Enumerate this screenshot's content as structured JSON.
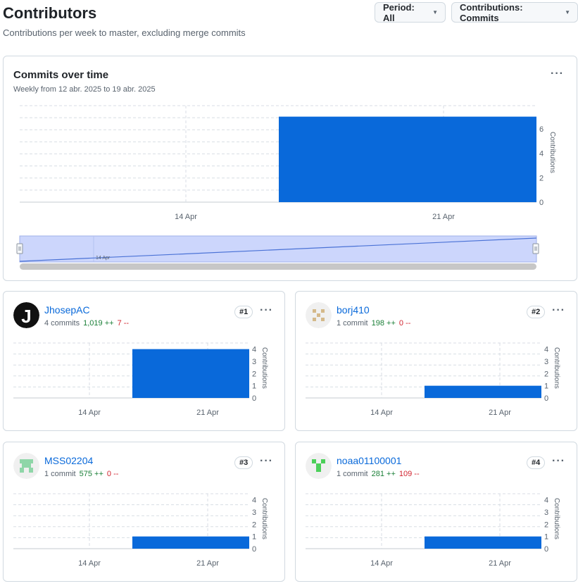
{
  "page": {
    "title": "Contributors",
    "subtitle": "Contributions per week to master, excluding merge commits"
  },
  "filters": {
    "period_label": "Period: All",
    "contributions_label": "Contributions: Commits"
  },
  "colors": {
    "bar": "#0969da",
    "grid": "#d8dee4",
    "navigator_fill": "#ccd6fc",
    "navigator_line": "#4a72d6",
    "additions": "#1a7f37",
    "deletions": "#d1242f",
    "link": "#0969da"
  },
  "main_chart": {
    "title": "Commits over time",
    "subtitle": "Weekly from 12 abr. 2025 to 19 abr. 2025",
    "more_label": "···",
    "navigator_label": "14 Apr",
    "chart_data": {
      "type": "bar",
      "x_ticks": [
        "14 Apr",
        "21 Apr"
      ],
      "bars": [
        {
          "week": "21 Apr",
          "value": 7
        }
      ],
      "ylabel": "Contributions",
      "y_ticks": [
        0,
        2,
        4,
        6
      ],
      "ylim": [
        0,
        7.9
      ],
      "grid": true
    }
  },
  "contributors": [
    {
      "username": "JhosepAC",
      "commits": "4 commits",
      "additions": "1,019 ++",
      "deletions": "7 --",
      "rank": "#1",
      "avatar_icon": "letter-j-avatar-icon",
      "chart_data": {
        "type": "bar",
        "x_ticks": [
          "14 Apr",
          "21 Apr"
        ],
        "value": 4,
        "y_ticks": [
          0,
          1,
          2,
          3,
          4
        ],
        "ylim": [
          0,
          4.5
        ],
        "ylabel": "Contributions"
      }
    },
    {
      "username": "borj410",
      "commits": "1 commit",
      "additions": "198 ++",
      "deletions": "0 --",
      "rank": "#2",
      "avatar_icon": "identicon-tan-avatar-icon",
      "chart_data": {
        "type": "bar",
        "x_ticks": [
          "14 Apr",
          "21 Apr"
        ],
        "value": 1,
        "y_ticks": [
          0,
          1,
          2,
          3,
          4
        ],
        "ylim": [
          0,
          4.5
        ],
        "ylabel": "Contributions"
      }
    },
    {
      "username": "MSS02204",
      "commits": "1 commit",
      "additions": "575 ++",
      "deletions": "0 --",
      "rank": "#3",
      "avatar_icon": "identicon-green-avatar-icon",
      "chart_data": {
        "type": "bar",
        "x_ticks": [
          "14 Apr",
          "21 Apr"
        ],
        "value": 1,
        "y_ticks": [
          0,
          1,
          2,
          3,
          4
        ],
        "ylim": [
          0,
          4.5
        ],
        "ylabel": "Contributions"
      }
    },
    {
      "username": "noaa01100001",
      "commits": "1 commit",
      "additions": "281 ++",
      "deletions": "109 --",
      "rank": "#4",
      "avatar_icon": "identicon-bright-green-avatar-icon",
      "chart_data": {
        "type": "bar",
        "x_ticks": [
          "14 Apr",
          "21 Apr"
        ],
        "value": 1,
        "y_ticks": [
          0,
          1,
          2,
          3,
          4
        ],
        "ylim": [
          0,
          4.5
        ],
        "ylabel": "Contributions"
      }
    }
  ]
}
